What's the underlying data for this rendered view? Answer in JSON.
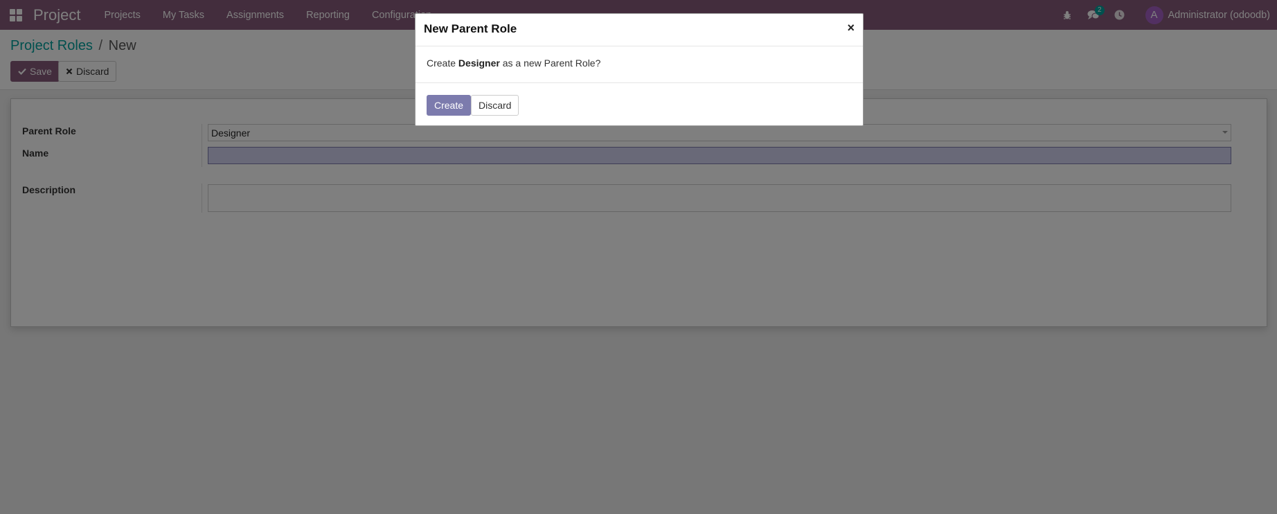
{
  "navbar": {
    "brand": "Project",
    "menu": [
      "Projects",
      "My Tasks",
      "Assignments",
      "Reporting",
      "Configuration"
    ],
    "chat_badge": "2",
    "user_initial": "A",
    "user_name": "Administrator (odoodb)"
  },
  "breadcrumb": {
    "parent": "Project Roles",
    "separator": "/",
    "current": "New"
  },
  "toolbar": {
    "save_label": "Save",
    "discard_label": "Discard"
  },
  "form": {
    "parent_role_label": "Parent Role",
    "parent_role_value": "Designer",
    "name_label": "Name",
    "name_value": "",
    "description_label": "Description",
    "description_value": ""
  },
  "modal": {
    "title": "New Parent Role",
    "close": "×",
    "body_prefix": "Create ",
    "body_bold": "Designer",
    "body_suffix": " as a new Parent Role?",
    "create_label": "Create",
    "discard_label": "Discard"
  },
  "colors": {
    "navbar": "#875a7b",
    "primary": "#7c7bad",
    "accent": "#00a09d"
  }
}
